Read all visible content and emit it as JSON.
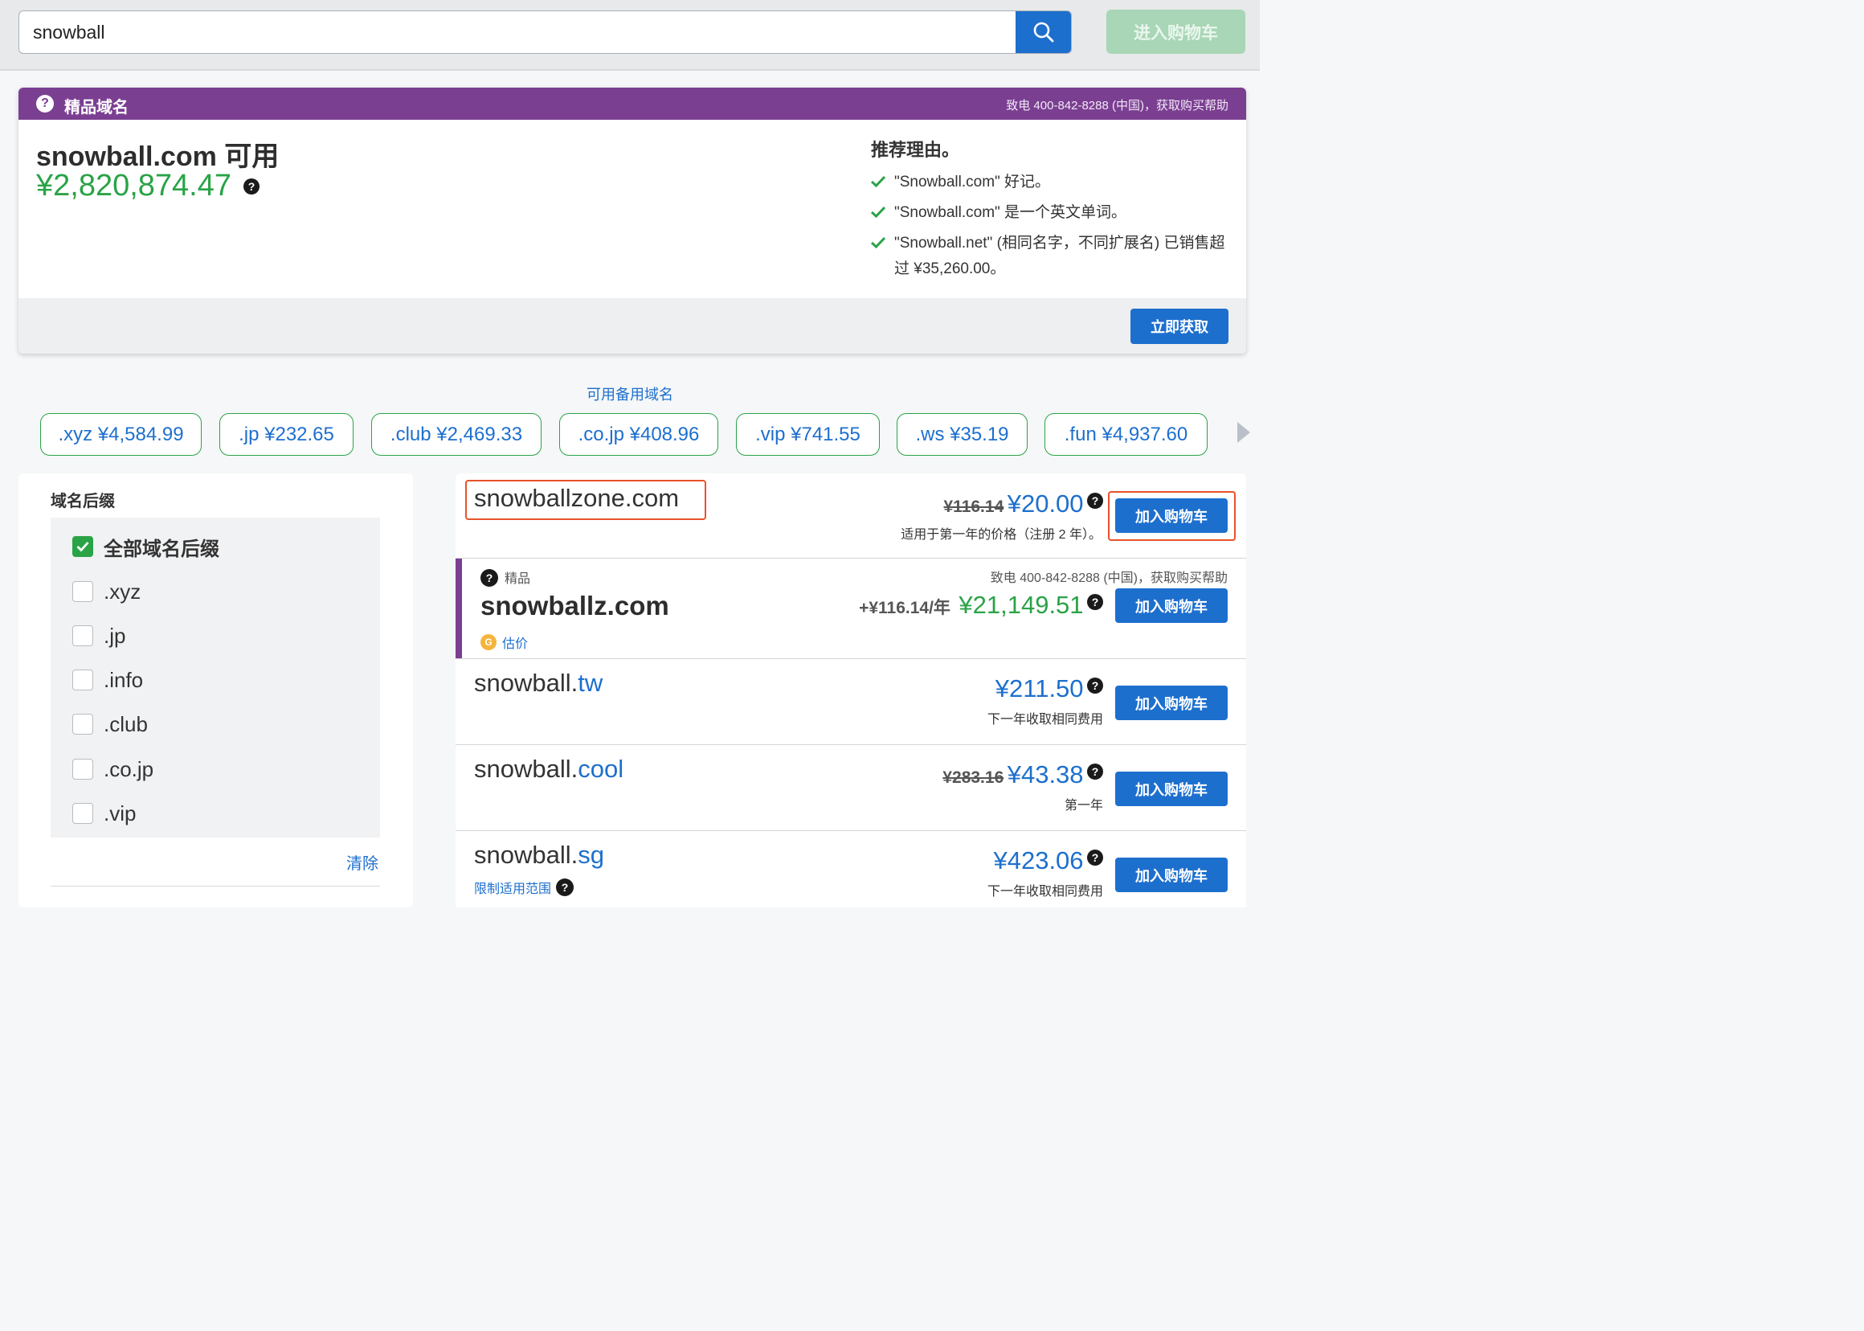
{
  "search": {
    "value": "snowball"
  },
  "top_cart_label": "进入购物车",
  "premium": {
    "title": "精品域名",
    "phone": "致电 400-842-8288 (中国)，获取购买帮助",
    "domain": "snowball.com 可用",
    "price": "¥2,820,874.47",
    "reasons_title": "推荐理由。",
    "reasons": [
      "\"Snowball.com\" 好记。",
      "\"Snowball.com\" 是一个英文单词。",
      "\"Snowball.net\" (相同名字，不同扩展名) 已销售超过 ¥35,260.00。"
    ],
    "cta": "立即获取"
  },
  "alternates": {
    "title": "可用备用域名",
    "chips": [
      ".xyz ¥4,584.99",
      ".jp ¥232.65",
      ".club ¥2,469.33",
      ".co.jp ¥408.96",
      ".vip ¥741.55",
      ".ws ¥35.19",
      ".fun ¥4,937.60"
    ]
  },
  "filter": {
    "title": "域名后缀",
    "items": [
      {
        "label": "全部域名后缀",
        "checked": true
      },
      {
        "label": ".xyz",
        "checked": false
      },
      {
        "label": ".jp",
        "checked": false
      },
      {
        "label": ".info",
        "checked": false
      },
      {
        "label": ".club",
        "checked": false
      },
      {
        "label": ".co.jp",
        "checked": false
      },
      {
        "label": ".vip",
        "checked": false
      }
    ],
    "clear": "清除"
  },
  "results": [
    {
      "name": "snowballzone.com",
      "tld": "",
      "old_price": "¥116.14",
      "price": "¥20.00",
      "note": "适用于第一年的价格（注册 2 年）。",
      "button": "加入购物车"
    },
    {
      "tag": "精品",
      "name": "snowballz.com",
      "phone": "致电 400-842-8288 (中国)，获取购买帮助",
      "extra": "+¥116.14/年",
      "price": "¥21,149.51",
      "appraise": "估价",
      "button": "加入购物车"
    },
    {
      "name": "snowball.",
      "tld": "tw",
      "price": "¥211.50",
      "note": "下一年收取相同费用",
      "button": "加入购物车"
    },
    {
      "name": "snowball.",
      "tld": "cool",
      "old_price": "¥283.16",
      "price": "¥43.38",
      "note": "第一年",
      "button": "加入购物车"
    },
    {
      "name": "snowball.",
      "tld": "sg",
      "price": "¥423.06",
      "note": "下一年收取相同费用",
      "restrict": "限制适用范围",
      "button": "加入购物车"
    }
  ],
  "colors": {
    "brand_blue": "#1d6fce",
    "green": "#2aa347",
    "purple": "#7b3f92",
    "highlight": "#e8522a"
  }
}
